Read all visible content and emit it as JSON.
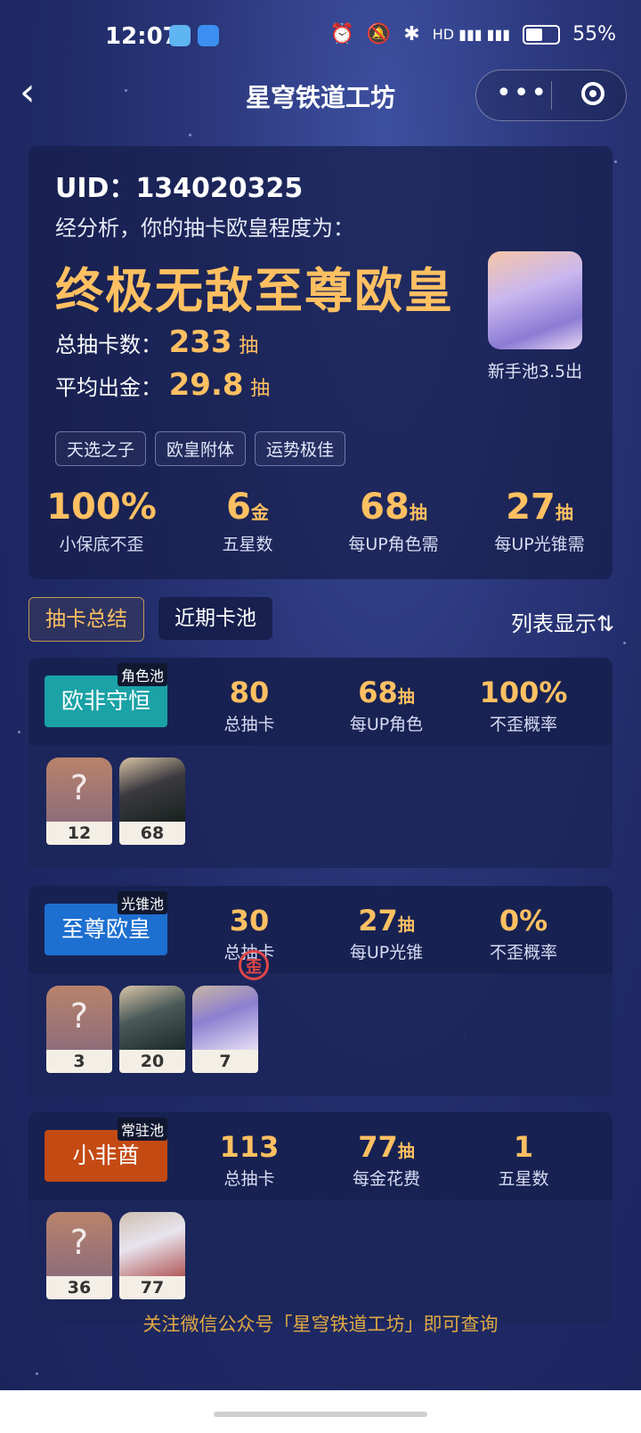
{
  "status_bar": {
    "time": "12:07",
    "battery": "55%"
  },
  "nav": {
    "back_icon": "chevron-left",
    "title": "星穹铁道工坊"
  },
  "summary": {
    "uid_label": "UID：",
    "uid": "134020325",
    "analysis_text": "经分析，你的抽卡欧皇程度为：",
    "rank_title": "终极无敌至尊欧皇",
    "total_label": "总抽卡数：",
    "total_value": "233",
    "total_unit": "抽",
    "avg_label": "平均出金：",
    "avg_value": "29.8",
    "avg_unit": "抽",
    "avatar_label": "新手池3.5出",
    "tags": [
      "天选之子",
      "欧皇附体",
      "运势极佳"
    ],
    "stats": [
      {
        "value": "100%",
        "unit": "",
        "label": "小保底不歪"
      },
      {
        "value": "6",
        "unit": "金",
        "label": "五星数"
      },
      {
        "value": "68",
        "unit": "抽",
        "label": "每UP角色需"
      },
      {
        "value": "27",
        "unit": "抽",
        "label": "每UP光锥需"
      }
    ]
  },
  "tabs": {
    "summary": "抽卡总结",
    "recent": "近期卡池",
    "list_toggle": "列表显示⇅"
  },
  "pools": [
    {
      "name": "欧非守恒",
      "type": "角色池",
      "color": "#1aa2a6",
      "stats": [
        {
          "value": "80",
          "unit": "",
          "label": "总抽卡"
        },
        {
          "value": "68",
          "unit": "抽",
          "label": "每UP角色"
        },
        {
          "value": "100%",
          "unit": "",
          "label": "不歪概率"
        }
      ],
      "items": [
        {
          "type": "unknown",
          "count": "12"
        },
        {
          "type": "character",
          "count": "68"
        }
      ]
    },
    {
      "name": "至尊欧皇",
      "type": "光锥池",
      "color": "#1d6fd0",
      "stats": [
        {
          "value": "30",
          "unit": "",
          "label": "总抽卡"
        },
        {
          "value": "27",
          "unit": "抽",
          "label": "每UP光锥"
        },
        {
          "value": "0%",
          "unit": "",
          "label": "不歪概率"
        }
      ],
      "items": [
        {
          "type": "unknown",
          "count": "3"
        },
        {
          "type": "lightcone",
          "count": "20"
        },
        {
          "type": "lightcone",
          "count": "7"
        }
      ],
      "off_banner_mark": "歪"
    },
    {
      "name": "小非酋",
      "type": "常驻池",
      "color": "#c44a14",
      "stats": [
        {
          "value": "113",
          "unit": "",
          "label": "总抽卡"
        },
        {
          "value": "77",
          "unit": "抽",
          "label": "每金花费"
        },
        {
          "value": "1",
          "unit": "",
          "label": "五星数"
        }
      ],
      "items": [
        {
          "type": "unknown",
          "count": "36"
        },
        {
          "type": "character",
          "count": "77"
        }
      ]
    }
  ],
  "footer": "关注微信公众号「星穹铁道工坊」即可查询"
}
